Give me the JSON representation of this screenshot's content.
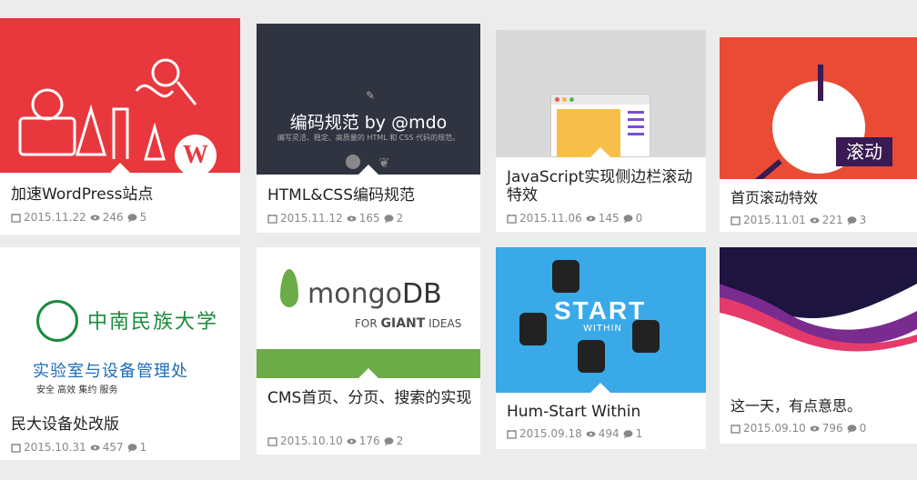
{
  "posts": [
    {
      "title": "加速WordPress站点",
      "date": "2015.11.22",
      "views": "246",
      "comments": "5",
      "bg": "#e8383d"
    },
    {
      "title": "HTML&CSS编码规范",
      "date": "2015.11.12",
      "views": "165",
      "comments": "2",
      "bg": "#2f3440",
      "thumb_title": "编码规范 by @mdo",
      "thumb_sub": "编写灵活、稳定、高质量的 HTML 和 CSS 代码的规范。"
    },
    {
      "title": "JavaScript实现侧边栏滚动特效",
      "date": "2015.11.06",
      "views": "145",
      "comments": "0",
      "bg": "#d9d9d9"
    },
    {
      "title": "首页滚动特效",
      "date": "2015.11.01",
      "views": "221",
      "comments": "3",
      "bg": "#ea4b35",
      "thumb_label": "滚动"
    },
    {
      "title": "民大设备处改版",
      "date": "2015.10.31",
      "views": "457",
      "comments": "1",
      "bg": "#ffffff",
      "thumb_univ": "中南民族大学",
      "thumb_dept": "实验室与设备管理处",
      "thumb_motto": "安全 高效 集约 服务"
    },
    {
      "title": "CMS首页、分页、搜索的实现",
      "date": "2015.10.10",
      "views": "176",
      "comments": "2",
      "bg": "#ffffff",
      "thumb_logo_a": "mongo",
      "thumb_logo_b": "DB",
      "thumb_tag_a": "FOR ",
      "thumb_tag_b": "GIANT",
      "thumb_tag_c": " IDEAS"
    },
    {
      "title": "Hum-Start Within",
      "date": "2015.09.18",
      "views": "494",
      "comments": "1",
      "bg": "#3aa9e8",
      "thumb_big": "START",
      "thumb_small": "WITHIN"
    },
    {
      "title": "这一天，有点意思。",
      "date": "2015.09.10",
      "views": "796",
      "comments": "0",
      "bg": "#ffffff"
    }
  ],
  "colors": {
    "meta": "#888888",
    "title": "#222222",
    "mongo_green": "#6cac48"
  }
}
